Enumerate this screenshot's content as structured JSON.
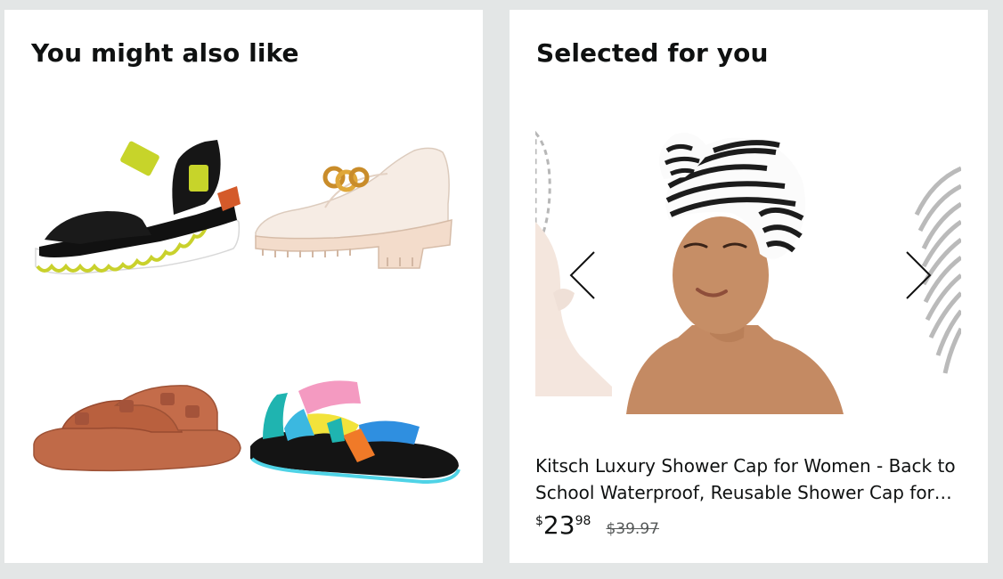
{
  "left_card": {
    "title": "You might also like",
    "items": [
      {
        "icon": "black-lime-platform-sandal"
      },
      {
        "icon": "cream-chunky-loafer"
      },
      {
        "icon": "brown-double-buckle-slide"
      },
      {
        "icon": "rainbow-strap-sport-sandal"
      }
    ]
  },
  "right_card": {
    "title": "Selected for you",
    "product": {
      "title_line1": "Kitsch Luxury Shower Cap for Women - Back to",
      "title_line2": "School Waterproof, Reusable Shower Cap for…",
      "price_symbol": "$",
      "price_whole": "23",
      "price_fraction": "98",
      "list_price": "$39.97"
    },
    "carousel": {
      "prev_icon": "chevron-left-icon",
      "next_icon": "chevron-right-icon"
    }
  },
  "colors": {
    "page_bg": "#e3e6e6",
    "card_bg": "#ffffff",
    "text": "#0f1111",
    "muted_text": "#565959"
  }
}
